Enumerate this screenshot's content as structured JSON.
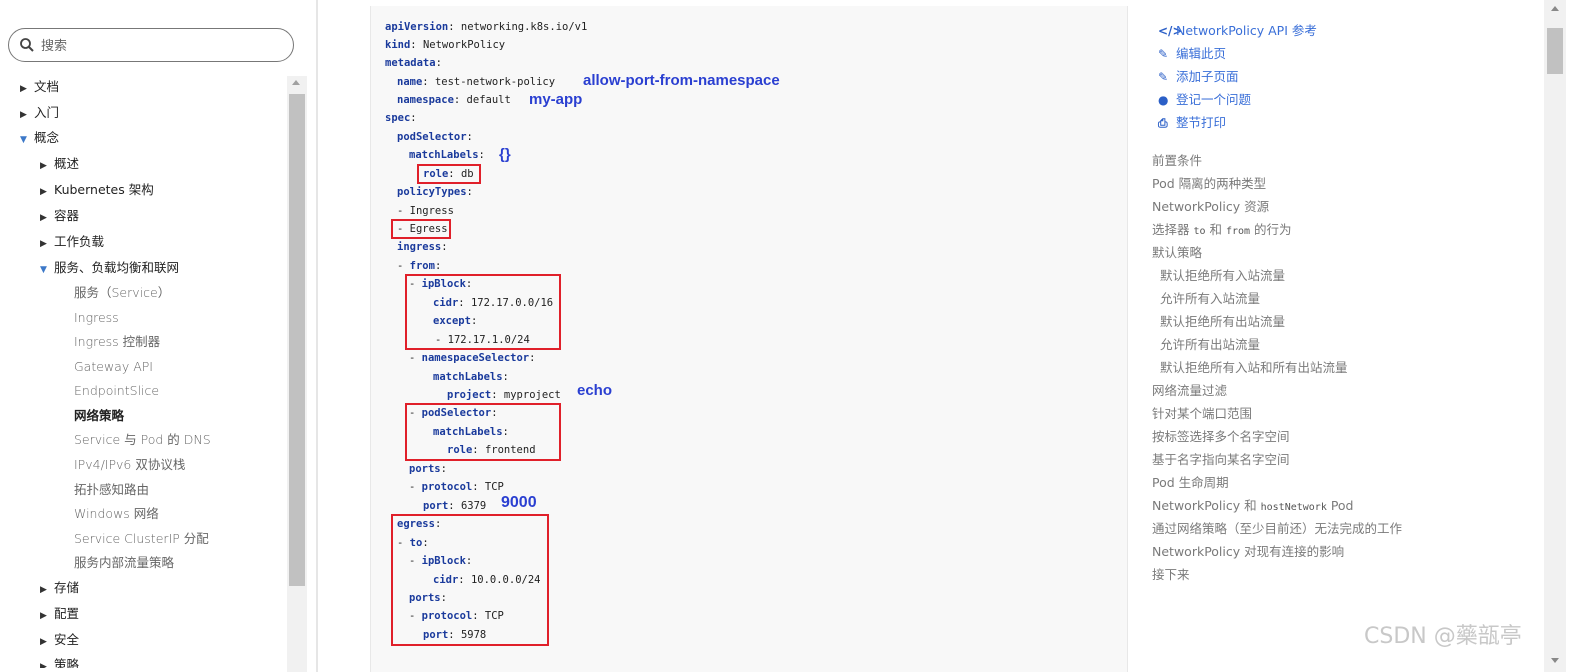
{
  "search": {
    "placeholder": "搜索"
  },
  "nav": {
    "docs": "文档",
    "getting_started": "入门",
    "concepts": "概念",
    "overview": "概述",
    "k8s_arch": "Kubernetes 架构",
    "containers": "容器",
    "workloads": "工作负载",
    "services_net": "服务、负载均衡和联网",
    "service": "服务（Service）",
    "ingress": "Ingress",
    "ingress_ctrl": "Ingress 控制器",
    "gateway_api": "Gateway API",
    "endpointslice": "EndpointSlice",
    "network_policy": "网络策略",
    "dns": "Service 与 Pod 的 DNS",
    "dual_stack": "IPv4/IPv6 双协议栈",
    "topology": "拓扑感知路由",
    "windows_net": "Windows 网络",
    "clusterip": "Service ClusterIP 分配",
    "internal_traffic": "服务内部流量策略",
    "storage": "存储",
    "config": "配置",
    "security": "安全",
    "policy": "策略"
  },
  "code": {
    "l1_key": "apiVersion",
    "l1_val": " networking.k8s.io/v1",
    "l2_key": "kind",
    "l2_val": " NetworkPolicy",
    "l3_key": "metadata",
    "l4_key": "name",
    "l4_val": " test-network-policy",
    "l5_key": "namespace",
    "l5_val": " default",
    "l6_key": "spec",
    "l7_key": "podSelector",
    "l8_key": "matchLabels",
    "l9_key": "role",
    "l9_val": " db",
    "l10_key": "policyTypes",
    "l11": "- Ingress",
    "l12": "- Egress",
    "l13_key": "ingress",
    "l14_key": "from",
    "l15_key": "ipBlock",
    "l16_key": "cidr",
    "l16_val": " 172.17.0.0/16",
    "l17_key": "except",
    "l18": "- 172.17.1.0/24",
    "l19_key": "namespaceSelector",
    "l20_key": "matchLabels",
    "l21_key": "project",
    "l21_val": " myproject",
    "l22_key": "podSelector",
    "l23_key": "matchLabels",
    "l24_key": "role",
    "l24_val": " frontend",
    "l25_key": "ports",
    "l26_key": "protocol",
    "l26_val": " TCP",
    "l27_key": "port",
    "l27_val": " 6379",
    "l28_key": "egress",
    "l29_key": "to",
    "l30_key": "ipBlock",
    "l31_key": "cidr",
    "l31_val": " 10.0.0.0/24",
    "l32_key": "ports",
    "l33_key": "protocol",
    "l33_val": " TCP",
    "l34_key": "port",
    "l34_val": " 5978"
  },
  "annotations": {
    "name": "allow-port-from-namespace",
    "namespace": "my-app",
    "match_labels": "{}",
    "project": "echo",
    "port": "9000"
  },
  "toc_actions": {
    "api_ref": "NetworkPolicy API 参考",
    "edit": "编辑此页",
    "add_child": "添加子页面",
    "issue": "登记一个问题",
    "print": "整节打印"
  },
  "toc": {
    "prereq": "前置条件",
    "isolation": "Pod 隔离的两种类型",
    "resource": "NetworkPolicy 资源",
    "selector_pre": "选择器 ",
    "selector_to": "to",
    "selector_mid": " 和 ",
    "selector_from": "from",
    "selector_post": " 的行为",
    "default": "默认策略",
    "deny_ingress": "默认拒绝所有入站流量",
    "allow_ingress": "允许所有入站流量",
    "deny_egress": "默认拒绝所有出站流量",
    "allow_egress": "允许所有出站流量",
    "deny_all": "默认拒绝所有入站和所有出站流量",
    "traffic_filter": "网络流量过滤",
    "port_range": "针对某个端口范围",
    "multi_ns": "按标签选择多个名字空间",
    "named_ns": "基于名字指向某名字空间",
    "lifecycle": "Pod 生命周期",
    "hostnet_pre": "NetworkPolicy 和 ",
    "hostnet_code": "hostNetwork",
    "hostnet_post": " Pod",
    "cannot": "通过网络策略（至少目前还）无法完成的工作",
    "existing": "NetworkPolicy 对现有连接的影响",
    "next": "接下来"
  },
  "watermark": "CSDN @藥瓿亭",
  "colors": {
    "annotation": "#2a3fd1",
    "highlight_box": "#e0202a",
    "code_key": "#1a3a9c",
    "link": "#3a6fd8"
  }
}
